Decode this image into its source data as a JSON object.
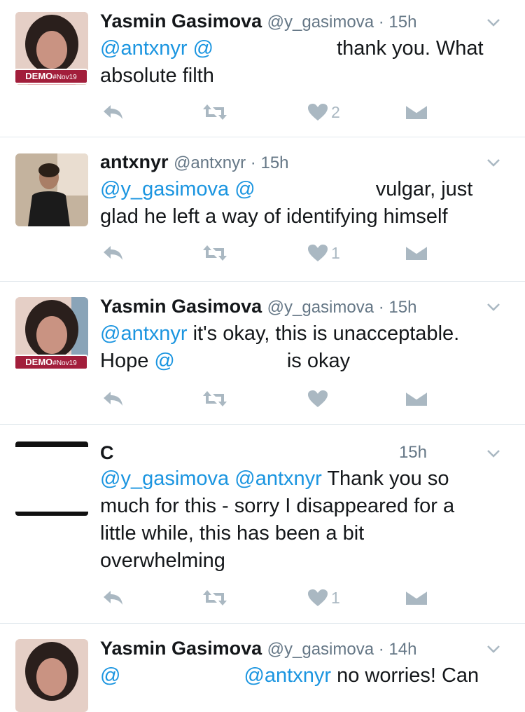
{
  "tweets": [
    {
      "name": "Yasmin Gasimova",
      "handle": "@y_gasimova",
      "time": "15h",
      "badge": {
        "main": "DEMO",
        "tag": "#Nov19"
      },
      "m1": "@antxnyr",
      "m2": "@",
      "t1": "thank you. What",
      "t2": "absolute filth",
      "likes": "2"
    },
    {
      "name": "antxnyr",
      "handle": "@antxnyr",
      "time": "15h",
      "m1": "@y_gasimova",
      "m2": "@",
      "t1": "vulgar, just",
      "t2": "glad he left a way of identifying himself",
      "likes": "1"
    },
    {
      "name": "Yasmin Gasimova",
      "handle": "@y_gasimova",
      "time": "15h",
      "badge": {
        "main": "DEMO",
        "tag": "#Nov19"
      },
      "m1": "@antxnyr",
      "t1": "it's okay, this is unacceptable.",
      "t2a": "Hope",
      "m2": "@",
      "t2b": "is okay",
      "likes": ""
    },
    {
      "name": "C",
      "time": "15h",
      "m1": "@y_gasimova",
      "m2": "@antxnyr",
      "t1": "Thank you so",
      "t2": "much for this - sorry I disappeared for a",
      "t3": "little while, this has been a bit",
      "t4": "overwhelming",
      "likes": "1"
    },
    {
      "name": "Yasmin Gasimova",
      "handle": "@y_gasimova",
      "time": "14h",
      "m1": "@",
      "m2": "@antxnyr",
      "t1": "no worries! Can"
    }
  ],
  "icons": {
    "reply": "reply-icon",
    "retweet": "retweet-icon",
    "like": "heart-icon",
    "dm": "direct-message-icon",
    "menu": "chevron-down-icon"
  },
  "colors": {
    "mention": "#1b95e0",
    "secondary": "#657786",
    "icon": "#aab8c2",
    "badge": "#a21e3b"
  }
}
